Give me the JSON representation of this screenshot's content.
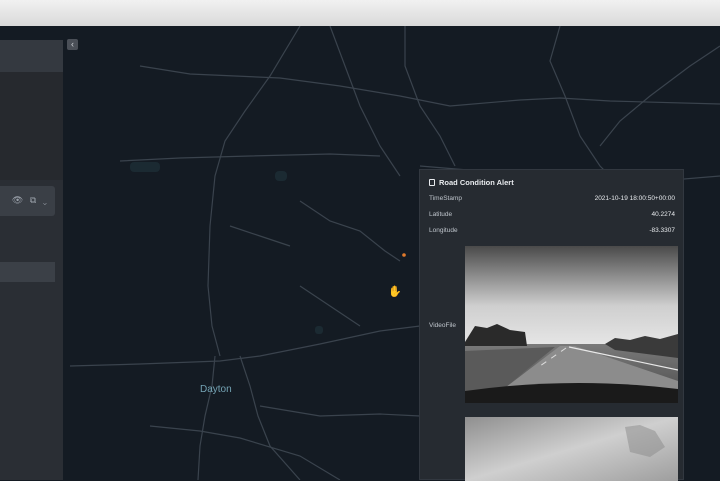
{
  "map": {
    "city_label": "Dayton"
  },
  "sidebar": {
    "row_icons": "👁 ⧉ ⌄",
    "collapse_icon": "‹"
  },
  "alert": {
    "title": "Road Condition Alert",
    "fields": {
      "timestamp_label": "TimeStamp",
      "timestamp_value": "2021-10-19 18:00:50+00:00",
      "latitude_label": "Latitude",
      "latitude_value": "40.2274",
      "longitude_label": "Longitude",
      "longitude_value": "-83.3307",
      "videofile_label": "VideoFile"
    }
  },
  "colors": {
    "map_bg": "#141b23",
    "road": "#3d4650",
    "panel_bg": "#262b31",
    "city_text": "#74a3b4",
    "event_dot": "#e07a2c"
  }
}
